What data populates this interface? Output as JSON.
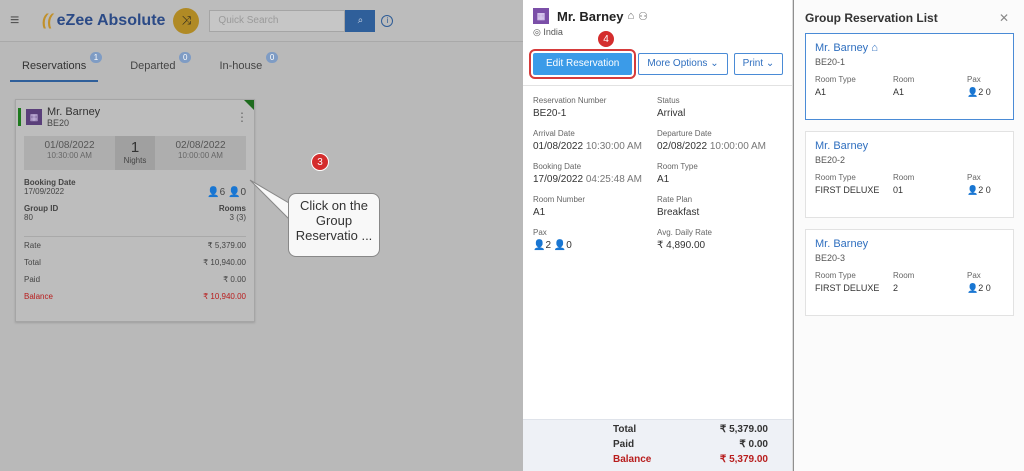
{
  "app": {
    "logo": "eZee Absolute",
    "search_placeholder": "Quick Search",
    "tabs": [
      {
        "label": "Reservations",
        "count": "1"
      },
      {
        "label": "Departed",
        "count": "0"
      },
      {
        "label": "In-house",
        "count": "0"
      }
    ],
    "card": {
      "name": "Mr. Barney",
      "code": "BE20",
      "arrival_date": "01/08/2022",
      "arrival_time": "10:30:00 AM",
      "nights": "1",
      "nights_label": "Nights",
      "departure_date": "02/08/2022",
      "departure_time": "10:00:00 AM",
      "booking_date_label": "Booking Date",
      "booking_date": "17/09/2022",
      "pax_adult": "6",
      "pax_child": "0",
      "group_id_label": "Group ID",
      "group_id": "80",
      "rooms_label": "Rooms",
      "rooms": "3 (3)",
      "rate_label": "Rate",
      "rate": "₹ 5,379.00",
      "total_label": "Total",
      "total": "₹ 10,940.00",
      "paid_label": "Paid",
      "paid": "₹ 0.00",
      "balance_label": "Balance",
      "balance": "₹ 10,940.00"
    },
    "step3": "3",
    "callout": "Click on the Group Reservatio ..."
  },
  "detail": {
    "name": "Mr. Barney",
    "location": "India",
    "step4": "4",
    "edit_btn": "Edit Reservation",
    "more_btn": "More Options",
    "print_btn": "Print",
    "fields": [
      {
        "label": "Reservation Number",
        "value": "BE20-1",
        "extra": ""
      },
      {
        "label": "Status",
        "value": "Arrival",
        "extra": ""
      },
      {
        "label": "Arrival Date",
        "value": "01/08/2022",
        "extra": "10:30:00 AM"
      },
      {
        "label": "Departure Date",
        "value": "02/08/2022",
        "extra": "10:00:00 AM"
      },
      {
        "label": "Booking Date",
        "value": "17/09/2022",
        "extra": "04:25:48 AM"
      },
      {
        "label": "Room Type",
        "value": "A1",
        "extra": ""
      },
      {
        "label": "Room Number",
        "value": "A1",
        "extra": ""
      },
      {
        "label": "Rate Plan",
        "value": "Breakfast",
        "extra": ""
      },
      {
        "label": "Pax",
        "value": "👤2 👤0",
        "extra": ""
      },
      {
        "label": "Avg. Daily Rate",
        "value": "₹ 4,890.00",
        "extra": ""
      }
    ],
    "summary": {
      "total_label": "Total",
      "total": "₹ 5,379.00",
      "paid_label": "Paid",
      "paid": "₹ 0.00",
      "balance_label": "Balance",
      "balance": "₹ 5,379.00"
    }
  },
  "group": {
    "title": "Group Reservation List",
    "col_room_type": "Room Type",
    "col_room": "Room",
    "col_pax": "Pax",
    "items": [
      {
        "name": "Mr. Barney",
        "code": "BE20-1",
        "room_type": "A1",
        "room": "A1",
        "pax": "2 0"
      },
      {
        "name": "Mr. Barney",
        "code": "BE20-2",
        "room_type": "FIRST DELUXE",
        "room": "01",
        "pax": "2 0"
      },
      {
        "name": "Mr. Barney",
        "code": "BE20-3",
        "room_type": "FIRST DELUXE",
        "room": "2",
        "pax": "2 0"
      }
    ]
  }
}
